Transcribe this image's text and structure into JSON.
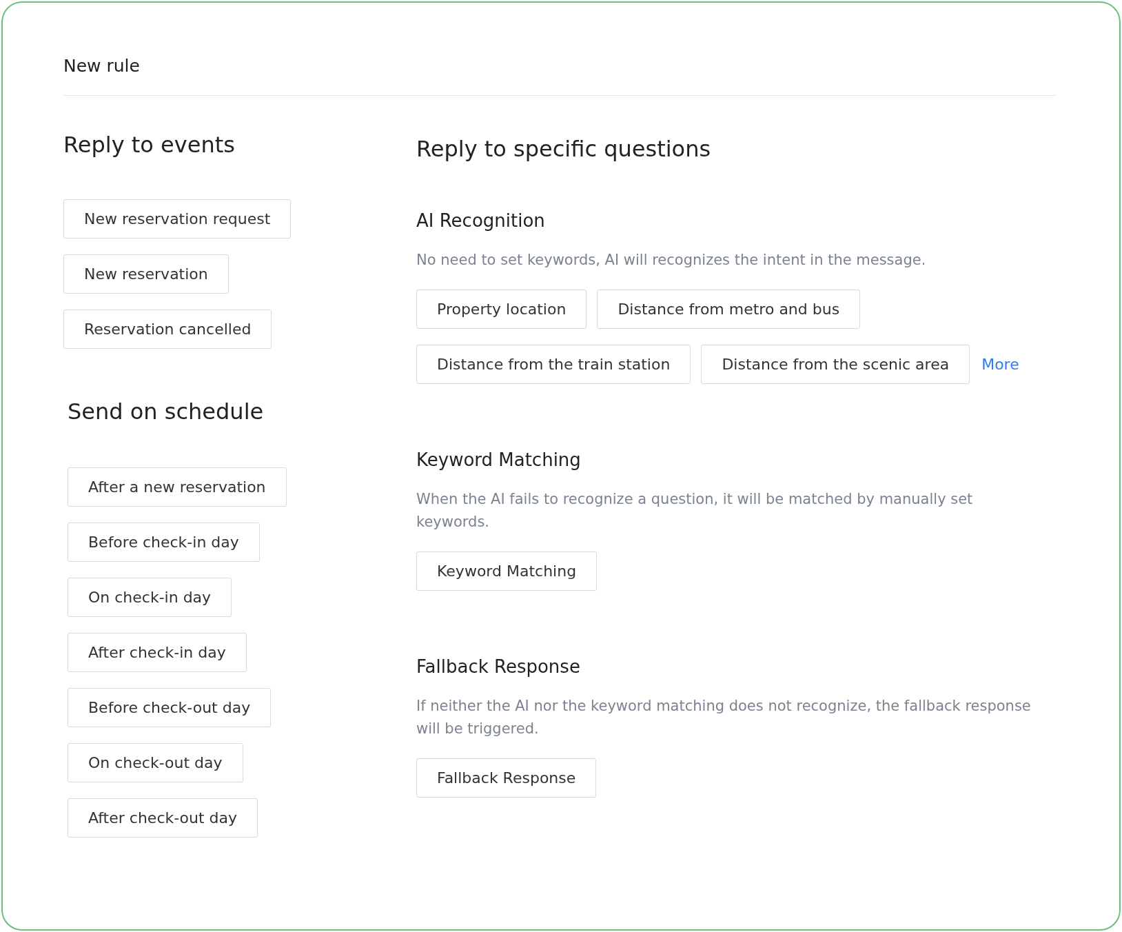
{
  "title": "New rule",
  "events": {
    "heading": "Reply to events",
    "options": [
      "New reservation request",
      "New reservation",
      "Reservation cancelled"
    ]
  },
  "schedule": {
    "heading": "Send on schedule",
    "options": [
      "After a new reservation",
      "Before check-in day",
      "On check-in day",
      "After check-in day",
      "Before check-out day",
      "On check-out day",
      "After check-out day"
    ]
  },
  "questions": {
    "heading": "Reply to specific questions",
    "sections": [
      {
        "heading": "AI Recognition",
        "description": "No need to set keywords, AI will recognizes the intent in the message.",
        "options": [
          "Property location",
          "Distance from metro and bus",
          "Distance from the train station",
          "Distance from the scenic area"
        ],
        "more": "More"
      },
      {
        "heading": "Keyword Matching",
        "description": "When the AI fails to recognize a question, it will be matched by manually set keywords.",
        "options": [
          "Keyword Matching"
        ]
      },
      {
        "heading": "Fallback Response",
        "description": "If neither the AI nor the keyword matching does not recognize, the fallback response will be triggered.",
        "options": [
          "Fallback Response"
        ]
      }
    ]
  }
}
